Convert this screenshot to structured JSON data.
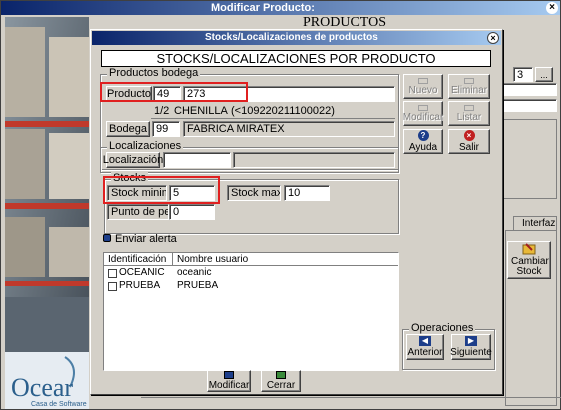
{
  "back_window": {
    "title": "Modificar Producto:",
    "heading": "PRODUCTOS",
    "spin_value": "3",
    "spin_button": "...",
    "tab_label": "Interfaz",
    "cambiar_stock_label": "Cambiar Stock"
  },
  "brand": {
    "logo_text": "Ocear",
    "tagline": "Casa de Software"
  },
  "dialog": {
    "title": "Stocks/Localizaciones de productos",
    "heading": "STOCKS/LOCALIZACIONES POR PRODUCTO",
    "productos_bodega": {
      "legend": "Productos bodega",
      "producto_button": "Producto",
      "producto_code": "49",
      "producto_id": "273",
      "producto_size": "1/2",
      "producto_name": "CHENILLA",
      "producto_barcode": "(<109220211100022)",
      "bodega_button": "Bodega",
      "bodega_code": "99",
      "bodega_name": "FABRICA MIRATEX"
    },
    "localizaciones": {
      "legend": "Localizaciones",
      "button": "Localización",
      "value": "",
      "description": ""
    },
    "stocks": {
      "legend": "Stocks",
      "min_label": "Stock minimo",
      "min_value": "5",
      "max_label": "Stock maximo",
      "max_value": "10",
      "punto_label": "Punto de pedido",
      "punto_value": "0"
    },
    "enviar_alerta": "Enviar alerta",
    "users_table": {
      "headers": [
        "Identificación",
        "Nombre usuario"
      ],
      "rows": [
        {
          "id": "OCEANIC",
          "name": "oceanic",
          "checked": false
        },
        {
          "id": "PRUEBA",
          "name": "PRUEBA",
          "checked": false
        }
      ]
    },
    "actions": {
      "nuevo": "Nuevo",
      "eliminar": "Eliminar",
      "modificar": "Modificar",
      "listar": "Listar",
      "ayuda": "Ayuda",
      "salir": "Salir"
    },
    "operaciones": {
      "legend": "Operaciones",
      "anterior": "Anterior",
      "siguiente": "Siguiente"
    },
    "footer": {
      "modificar": "Modificar",
      "cerrar": "Cerrar"
    }
  },
  "colors": {
    "titlebar_start": "#0a246a",
    "titlebar_end": "#a6caf0",
    "face": "#d4d0c8",
    "highlight": "#e02020"
  }
}
